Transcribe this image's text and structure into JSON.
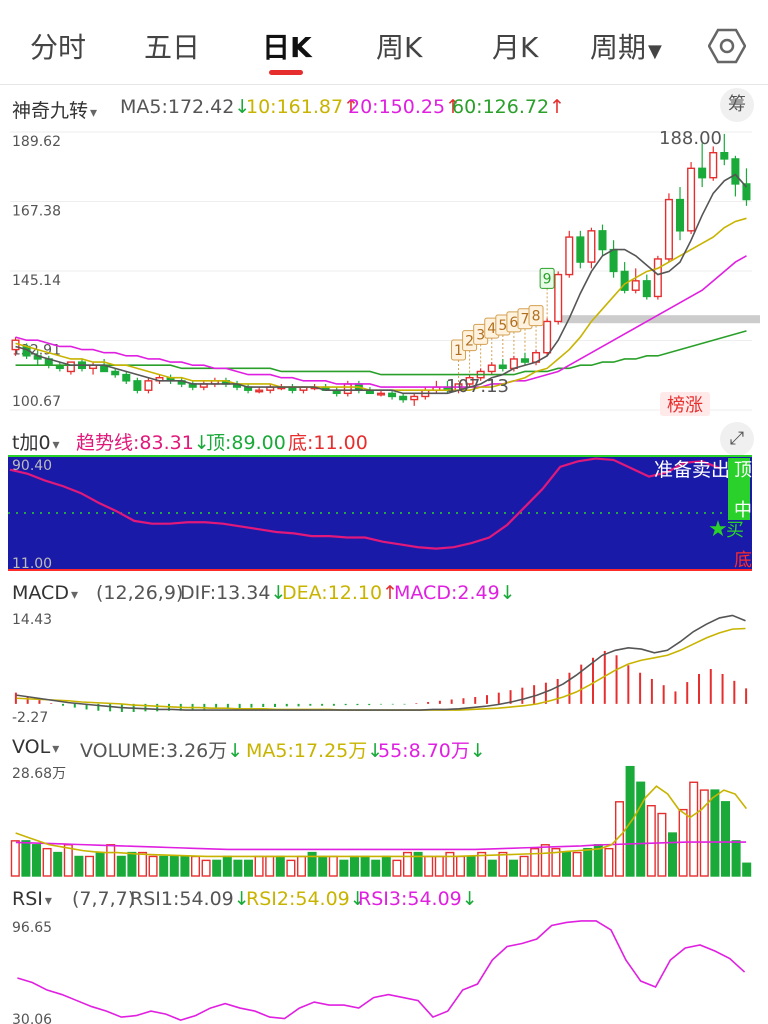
{
  "tabs": [
    "分时",
    "五日",
    "日K",
    "周K",
    "月K",
    "周期"
  ],
  "active_tab": "日K",
  "main_header": {
    "indicator": "神奇九转",
    "ma5": "MA5:172.42",
    "ma5_arrow": "↓",
    "ma10": "10:161.87",
    "ma10_arrow": "↑",
    "ma20": "20:150.25",
    "ma20_arrow": "↑",
    "ma60": "60:126.72",
    "ma60_arrow": "↑",
    "chip_button": "筹"
  },
  "tjia0_header": {
    "indicator": "t加0",
    "trend": "趋势线:83.31",
    "trend_arrow": "↓",
    "top": "顶:89.00",
    "bottom": "底:11.00",
    "expand_icon": "expand-icon"
  },
  "macd_header": {
    "indicator": "MACD",
    "params": "(12,26,9)",
    "dif": "DIF:13.34",
    "dif_arrow": "↓",
    "dea": "DEA:12.10",
    "dea_arrow": "↑",
    "macd": "MACD:2.49",
    "macd_arrow": "↓"
  },
  "vol_header": {
    "indicator": "VOL",
    "volume": "VOLUME:3.26万",
    "volume_arrow": "↓",
    "ma5": "MA5:17.25万",
    "ma5_arrow": "↓",
    "ma55": "55:8.70万",
    "ma55_arrow": "↓"
  },
  "rsi_header": {
    "indicator": "RSI",
    "params": "(7,7,7)",
    "rsi1": "RSI1:54.09",
    "rsi1_arrow": "↓",
    "rsi2": "RSI2:54.09",
    "rsi2_arrow": "↓",
    "rsi3": "RSI3:54.09",
    "rsi3_arrow": "↓"
  },
  "colors": {
    "up": "#e62e2e",
    "down": "#1aaa3a",
    "ma5": "#555555",
    "ma10": "#c8b400",
    "ma20": "#e020e0",
    "ma60": "#2aa02a",
    "zone_bg": "#1a1aa8"
  },
  "chart_data": [
    {
      "type": "candlestick",
      "ylim": [
        100.67,
        189.62
      ],
      "y_ticks": [
        "189.62",
        "167.38",
        "145.14",
        "122.91",
        "100.67"
      ],
      "labels": {
        "high": "188.00",
        "low": "107.13",
        "badge": "榜涨",
        "td_numbers": [
          "1",
          "2",
          "3",
          "4",
          "5",
          "6",
          "7",
          "8",
          "9"
        ]
      },
      "ohlc": [
        [
          120,
          124,
          118,
          123
        ],
        [
          121,
          122,
          117,
          118
        ],
        [
          118,
          120,
          115,
          117
        ],
        [
          117,
          118,
          114,
          115
        ],
        [
          115,
          116,
          113,
          114
        ],
        [
          113,
          116,
          112,
          116
        ],
        [
          116,
          117,
          113,
          114
        ],
        [
          114,
          116,
          112,
          115
        ],
        [
          115,
          117,
          113,
          113
        ],
        [
          113,
          114,
          111,
          112
        ],
        [
          112,
          113,
          109,
          110
        ],
        [
          110,
          111,
          106,
          107
        ],
        [
          107,
          111,
          106,
          110
        ],
        [
          110,
          112,
          109,
          111
        ],
        [
          111,
          112,
          109,
          110
        ],
        [
          110,
          111,
          108,
          109
        ],
        [
          109,
          110,
          107,
          108
        ],
        [
          108,
          110,
          107,
          109
        ],
        [
          109,
          111,
          108,
          110
        ],
        [
          110,
          111,
          108,
          109
        ],
        [
          109,
          110,
          107,
          108
        ],
        [
          108,
          109,
          106,
          107
        ],
        [
          107,
          108,
          106,
          107
        ],
        [
          107,
          109,
          106,
          108
        ],
        [
          108,
          109,
          107,
          108
        ],
        [
          108,
          109,
          106,
          107
        ],
        [
          107,
          108,
          106,
          108
        ],
        [
          108,
          109,
          107,
          108
        ],
        [
          108,
          109,
          107,
          107
        ],
        [
          107,
          108,
          105,
          106
        ],
        [
          106,
          110,
          105,
          109
        ],
        [
          109,
          110,
          106,
          107
        ],
        [
          107,
          108,
          106,
          106
        ],
        [
          106,
          107,
          105,
          106
        ],
        [
          106,
          107,
          104,
          105
        ],
        [
          105,
          106,
          103,
          104
        ],
        [
          104,
          106,
          102,
          105
        ],
        [
          105,
          108,
          104,
          107
        ],
        [
          107,
          110,
          106,
          108
        ],
        [
          108,
          110,
          106,
          107
        ],
        [
          107,
          109,
          106,
          109
        ],
        [
          109,
          112,
          108,
          111
        ],
        [
          111,
          114,
          110,
          113
        ],
        [
          113,
          116,
          112,
          115
        ],
        [
          115,
          117,
          113,
          114
        ],
        [
          114,
          118,
          113,
          117
        ],
        [
          117,
          119,
          115,
          116
        ],
        [
          116,
          120,
          115,
          119
        ],
        [
          119,
          130,
          118,
          129
        ],
        [
          129,
          145,
          128,
          144
        ],
        [
          144,
          158,
          143,
          156
        ],
        [
          156,
          158,
          146,
          148
        ],
        [
          148,
          159,
          146,
          158
        ],
        [
          158,
          160,
          150,
          152
        ],
        [
          152,
          155,
          143,
          145
        ],
        [
          145,
          148,
          138,
          139
        ],
        [
          139,
          146,
          138,
          142
        ],
        [
          142,
          144,
          136,
          137
        ],
        [
          137,
          150,
          136,
          149
        ],
        [
          149,
          170,
          148,
          168
        ],
        [
          168,
          172,
          155,
          158
        ],
        [
          158,
          180,
          157,
          178
        ],
        [
          178,
          186,
          172,
          175
        ],
        [
          175,
          185,
          174,
          183
        ],
        [
          183,
          189,
          179,
          181
        ],
        [
          181,
          182,
          169,
          173
        ],
        [
          173,
          178,
          166,
          168
        ]
      ],
      "ma5": [
        121,
        120,
        118,
        117,
        116,
        115,
        115,
        115,
        115,
        114,
        113,
        112,
        111,
        110,
        110,
        110,
        109,
        109,
        109,
        109,
        109,
        108,
        108,
        108,
        108,
        108,
        108,
        108,
        107,
        107,
        107,
        107,
        107,
        107,
        107,
        106,
        106,
        106,
        106,
        106,
        107,
        108,
        109,
        111,
        112,
        114,
        115,
        116,
        118,
        123,
        130,
        138,
        145,
        150,
        152,
        152,
        150,
        147,
        144,
        145,
        148,
        155,
        163,
        170,
        174,
        176,
        172
      ],
      "ma10": [
        122,
        121,
        120,
        119,
        118,
        117,
        117,
        116,
        116,
        115,
        115,
        114,
        113,
        112,
        111,
        111,
        110,
        110,
        110,
        110,
        109,
        109,
        109,
        109,
        108,
        108,
        108,
        108,
        108,
        108,
        108,
        108,
        107,
        107,
        107,
        107,
        107,
        107,
        107,
        107,
        107,
        107,
        108,
        108,
        109,
        110,
        111,
        113,
        114,
        117,
        120,
        124,
        129,
        133,
        137,
        141,
        143,
        145,
        146,
        148,
        150,
        152,
        154,
        156,
        159,
        161,
        162
      ],
      "ma20": [
        124,
        123,
        123,
        122,
        121,
        121,
        120,
        120,
        119,
        119,
        118,
        118,
        117,
        117,
        116,
        116,
        115,
        115,
        114,
        114,
        113,
        112,
        112,
        112,
        111,
        111,
        110,
        110,
        110,
        109,
        109,
        109,
        109,
        108,
        108,
        108,
        108,
        108,
        108,
        108,
        108,
        108,
        108,
        109,
        109,
        110,
        110,
        111,
        112,
        113,
        115,
        117,
        119,
        121,
        123,
        125,
        127,
        129,
        131,
        133,
        135,
        137,
        139,
        142,
        145,
        148,
        150
      ],
      "ma60": [
        115,
        115,
        115,
        115,
        115,
        115,
        115,
        115,
        115,
        115,
        115,
        115,
        115,
        115,
        115,
        114,
        114,
        114,
        114,
        114,
        114,
        114,
        114,
        114,
        113,
        113,
        113,
        113,
        113,
        113,
        113,
        113,
        113,
        112,
        112,
        112,
        112,
        112,
        112,
        112,
        112,
        112,
        112,
        112,
        112,
        112,
        113,
        113,
        113,
        114,
        114,
        115,
        115,
        116,
        116,
        117,
        117,
        118,
        118,
        119,
        120,
        121,
        122,
        123,
        124,
        125,
        126
      ]
    },
    {
      "type": "line",
      "ylim": [
        11.0,
        90.4
      ],
      "y_ticks": [
        "90.40",
        "11.00"
      ],
      "labels": {
        "sell": "准备卖出",
        "top": "顶",
        "mid": "中",
        "buy": "买",
        "bottom": "底"
      },
      "trend": [
        82,
        79,
        74,
        70,
        65,
        58,
        52,
        45,
        43,
        43,
        44,
        44,
        43,
        41,
        39,
        37,
        36,
        34,
        34,
        33,
        33,
        30,
        28,
        26,
        25,
        26,
        29,
        33,
        42,
        55,
        68,
        84,
        88,
        90,
        89,
        83,
        77,
        80,
        87,
        88,
        83
      ]
    },
    {
      "type": "bar+line",
      "ylim": [
        -2.27,
        14.43
      ],
      "y_ticks": [
        "14.43",
        "-2.27"
      ],
      "macd": [
        1.8,
        1.2,
        0.6,
        0.1,
        -0.3,
        -0.6,
        -0.9,
        -1.1,
        -1.2,
        -1.3,
        -1.3,
        -1.2,
        -1.2,
        -1.1,
        -1.1,
        -1.0,
        -0.9,
        -0.8,
        -0.8,
        -0.7,
        -0.6,
        -0.5,
        -0.5,
        -0.4,
        -0.4,
        -0.3,
        -0.3,
        -0.3,
        -0.2,
        -0.2,
        -0.2,
        -0.1,
        -0.1,
        -0.1,
        0.1,
        0.3,
        0.5,
        0.7,
        0.9,
        1.1,
        1.4,
        1.8,
        2.2,
        2.6,
        3.0,
        3.4,
        4.0,
        5.0,
        6.3,
        7.4,
        8.5,
        7.8,
        6.2,
        5.0,
        4.0,
        3.0,
        2.0,
        3.5,
        4.8,
        5.6,
        4.8,
        3.7,
        2.49
      ],
      "dif": [
        1.4,
        1.1,
        0.8,
        0.5,
        0.2,
        0.0,
        -0.2,
        -0.4,
        -0.6,
        -0.7,
        -0.8,
        -0.9,
        -0.9,
        -1.0,
        -1.0,
        -1.0,
        -1.0,
        -1.0,
        -1.0,
        -1.0,
        -1.0,
        -1.0,
        -1.0,
        -1.0,
        -1.0,
        -1.0,
        -1.0,
        -1.0,
        -1.0,
        -1.0,
        -1.0,
        -1.0,
        -0.9,
        -0.9,
        -0.8,
        -0.6,
        -0.4,
        -0.1,
        0.3,
        0.8,
        1.4,
        2.2,
        3.2,
        4.6,
        6.2,
        7.8,
        8.6,
        9.0,
        8.8,
        8.2,
        8.6,
        10.0,
        11.6,
        12.8,
        13.8,
        14.2,
        13.34
      ],
      "dea": [
        0.9,
        0.8,
        0.7,
        0.6,
        0.5,
        0.3,
        0.2,
        0.1,
        0.0,
        -0.2,
        -0.3,
        -0.4,
        -0.5,
        -0.6,
        -0.6,
        -0.7,
        -0.7,
        -0.8,
        -0.8,
        -0.8,
        -0.9,
        -0.9,
        -0.9,
        -0.9,
        -0.9,
        -1.0,
        -1.0,
        -1.0,
        -1.0,
        -1.0,
        -1.0,
        -1.0,
        -1.0,
        -1.0,
        -1.0,
        -0.9,
        -0.8,
        -0.7,
        -0.5,
        -0.3,
        0.0,
        0.5,
        1.1,
        1.9,
        3.0,
        4.2,
        5.4,
        6.4,
        7.0,
        7.4,
        7.8,
        8.6,
        9.6,
        10.6,
        11.4,
        12.0,
        12.1
      ]
    },
    {
      "type": "bar+line",
      "ylim": [
        0,
        28.68
      ],
      "y_ticks": [
        "28.68万"
      ],
      "volume": [
        9,
        9,
        8,
        7,
        6,
        8,
        5,
        5,
        6,
        8,
        5,
        6,
        6,
        5,
        5,
        5,
        5,
        5,
        4,
        4,
        5,
        4,
        4,
        5,
        5,
        5,
        4,
        5,
        6,
        5,
        5,
        4,
        5,
        5,
        4,
        5,
        4,
        6,
        6,
        5,
        5,
        6,
        5,
        5,
        6,
        4,
        6,
        4,
        5,
        7,
        8,
        7,
        6,
        6,
        7,
        8,
        7,
        19,
        28,
        24,
        18,
        16,
        11,
        17,
        24,
        22,
        22,
        19,
        9,
        3.26
      ],
      "volume_up": [
        1,
        0,
        0,
        1,
        0,
        1,
        0,
        1,
        0,
        1,
        0,
        0,
        1,
        1,
        0,
        0,
        0,
        1,
        1,
        0,
        0,
        0,
        0,
        1,
        1,
        0,
        1,
        1,
        0,
        0,
        1,
        0,
        0,
        0,
        0,
        0,
        1,
        1,
        0,
        1,
        1,
        1,
        1,
        0,
        1,
        0,
        1,
        0,
        1,
        1,
        1,
        1,
        0,
        1,
        0,
        0,
        1,
        1,
        0,
        0,
        1,
        1,
        0,
        1,
        1,
        1,
        0,
        0,
        0
      ],
      "ma5": [
        11,
        10,
        9,
        8,
        7.5,
        7,
        6.5,
        6.2,
        6,
        6,
        5.8,
        5.6,
        5.5,
        5.4,
        5.3,
        5.2,
        5.1,
        5,
        5,
        5,
        5,
        5,
        5,
        5,
        5,
        5,
        5,
        5,
        5,
        5,
        5,
        5,
        5,
        5,
        5,
        5,
        5,
        5,
        5,
        5,
        5.1,
        5.2,
        5.3,
        5.4,
        5.5,
        5.6,
        5.7,
        5.8,
        6,
        6.3,
        6.5,
        6.7,
        7,
        8,
        11,
        15,
        20,
        23,
        21,
        17,
        15,
        17,
        20,
        22,
        21,
        17.25
      ],
      "ma55": [
        8.6,
        8.5,
        8.4,
        8.3,
        8.2,
        8.1,
        8.0,
        7.9,
        7.8,
        7.7,
        7.6,
        7.5,
        7.4,
        7.3,
        7.2,
        7.1,
        7.0,
        6.9,
        6.8,
        6.8,
        6.8,
        6.8,
        6.8,
        6.8,
        6.8,
        6.8,
        6.8,
        6.8,
        6.8,
        6.8,
        6.8,
        6.8,
        6.8,
        6.8,
        6.8,
        6.8,
        6.8,
        6.8,
        6.8,
        6.8,
        6.9,
        7.0,
        7.1,
        7.2,
        7.3,
        7.4,
        7.5,
        7.6,
        7.7,
        7.9,
        8.0,
        8.1,
        8.2,
        8.3,
        8.4,
        8.5,
        8.6,
        8.7,
        8.7,
        8.7,
        8.7,
        8.7,
        8.7
      ]
    },
    {
      "type": "line",
      "ylim": [
        30.06,
        96.65
      ],
      "y_ticks": [
        "96.65",
        "30.06"
      ],
      "rsi": [
        58,
        55,
        50,
        47,
        43,
        39,
        36,
        32,
        33,
        36,
        34,
        30,
        33,
        38,
        41,
        38,
        36,
        32,
        31,
        38,
        42,
        40,
        40,
        38,
        45,
        47,
        45,
        43,
        32,
        36,
        50,
        54,
        70,
        79,
        81,
        84,
        93,
        95,
        96,
        96,
        90,
        70,
        56,
        52,
        70,
        78,
        80,
        76,
        71,
        62
      ]
    }
  ]
}
